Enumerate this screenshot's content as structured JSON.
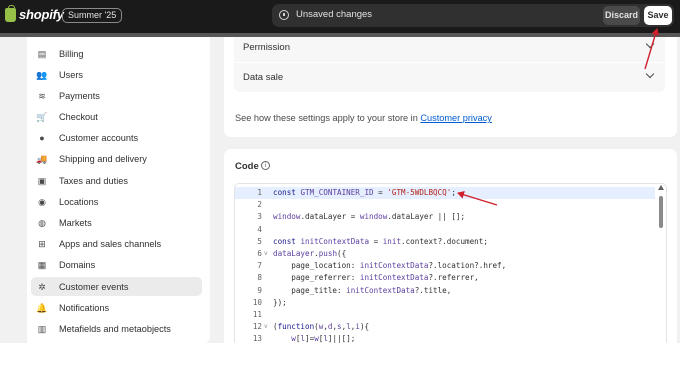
{
  "topbar": {
    "logo_text": "shopify",
    "edition_badge": "Summer '25",
    "unsaved_text": "Unsaved changes",
    "discard_label": "Discard",
    "save_label": "Save"
  },
  "sidebar": {
    "items": [
      {
        "label": "Billing",
        "icon": "billing-icon",
        "glyph": "▤"
      },
      {
        "label": "Users",
        "icon": "users-icon",
        "glyph": "👥"
      },
      {
        "label": "Payments",
        "icon": "payments-icon",
        "glyph": "≋"
      },
      {
        "label": "Checkout",
        "icon": "cart-icon",
        "glyph": "🛒"
      },
      {
        "label": "Customer accounts",
        "icon": "customer-icon",
        "glyph": "●"
      },
      {
        "label": "Shipping and delivery",
        "icon": "truck-icon",
        "glyph": "🚚"
      },
      {
        "label": "Taxes and duties",
        "icon": "taxes-icon",
        "glyph": "▣"
      },
      {
        "label": "Locations",
        "icon": "location-icon",
        "glyph": "◉"
      },
      {
        "label": "Markets",
        "icon": "globe-icon",
        "glyph": "◍"
      },
      {
        "label": "Apps and sales channels",
        "icon": "apps-icon",
        "glyph": "⊞"
      },
      {
        "label": "Domains",
        "icon": "domains-icon",
        "glyph": "▦"
      },
      {
        "label": "Customer events",
        "icon": "events-icon",
        "glyph": "✲",
        "active": true
      },
      {
        "label": "Notifications",
        "icon": "bell-icon",
        "glyph": "🔔"
      },
      {
        "label": "Metafields and metaobjects",
        "icon": "metafields-icon",
        "glyph": "▥"
      }
    ]
  },
  "settings": {
    "permission_label": "Permission",
    "data_sale_label": "Data sale",
    "privacy_note": "See how these settings apply to your store in ",
    "privacy_link": "Customer privacy"
  },
  "code": {
    "title": "Code",
    "lines": [
      {
        "n": "1",
        "fold": "",
        "html": "<span class=\"kw\">const</span> <span class=\"vr\">GTM_CONTAINER_ID</span> = <span class=\"str\">'GTM-5WDLBQCQ'</span>;"
      },
      {
        "n": "2",
        "fold": "",
        "html": ""
      },
      {
        "n": "3",
        "fold": "",
        "html": "<span class=\"vr\">window</span>.<span class=\"prop\">dataLayer</span> = <span class=\"vr\">window</span>.<span class=\"prop\">dataLayer</span> || [];"
      },
      {
        "n": "4",
        "fold": "",
        "html": ""
      },
      {
        "n": "5",
        "fold": "",
        "html": "<span class=\"kw\">const</span> <span class=\"vr\">initContextData</span> = <span class=\"vr\">init</span>.context?.document;"
      },
      {
        "n": "6",
        "fold": "v",
        "html": "<span class=\"vr\">dataLayer</span>.<span class=\"fn\">push</span>({"
      },
      {
        "n": "7",
        "fold": "",
        "html": "    page_location: <span class=\"vr\">initContextData</span>?.location?.href,"
      },
      {
        "n": "8",
        "fold": "",
        "html": "    page_referrer: <span class=\"vr\">initContextData</span>?.referrer,"
      },
      {
        "n": "9",
        "fold": "",
        "html": "    page_title: <span class=\"vr\">initContextData</span>?.title,"
      },
      {
        "n": "10",
        "fold": "",
        "html": "});"
      },
      {
        "n": "11",
        "fold": "",
        "html": ""
      },
      {
        "n": "12",
        "fold": "v",
        "html": "(<span class=\"kw\">function</span>(<span class=\"vr\">w</span>,<span class=\"vr\">d</span>,<span class=\"vr\">s</span>,<span class=\"vr\">l</span>,<span class=\"vr\">i</span>){"
      },
      {
        "n": "13",
        "fold": "",
        "html": "    <span class=\"vr\">w</span>[<span class=\"vr\">l</span>]=<span class=\"vr\">w</span>[<span class=\"vr\">l</span>]||[];"
      }
    ]
  },
  "colors": {
    "topbar_bg": "#1a1a1a",
    "page_bg": "#f1f1f1",
    "annotation_arrow": "#d0202e",
    "link": "#005bd3"
  }
}
